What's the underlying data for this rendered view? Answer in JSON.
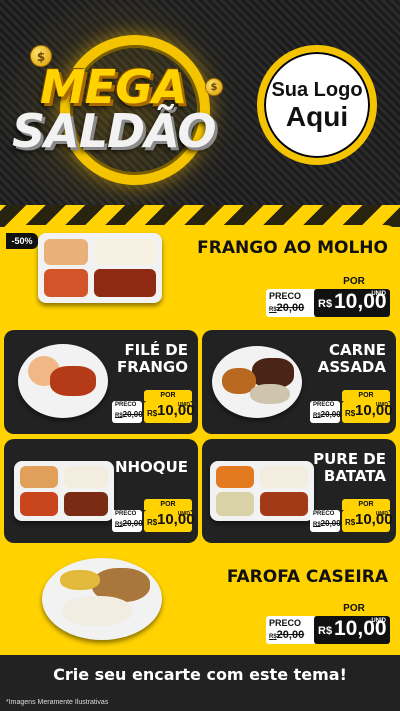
{
  "header": {
    "title_line1": "MEGA",
    "title_line2": "SALDÃO",
    "coin_symbol": "$",
    "logo_line1": "Sua Logo",
    "logo_line2": "Aqui"
  },
  "badge": "-50%",
  "products": [
    {
      "name_lines": [
        "FRANGO AO MOLHO"
      ],
      "price_label": "PRECO",
      "old_price": "20,00",
      "old_prefix": "R$",
      "per_label": "POR",
      "currency": "R$",
      "new_price": "10,00",
      "unit": "UNID"
    },
    {
      "name_lines": [
        "FILÉ DE",
        "FRANGO"
      ],
      "price_label": "PRECO",
      "old_price": "20,00",
      "old_prefix": "R$",
      "per_label": "POR",
      "currency": "R$",
      "new_price": "10,00",
      "unit": "UNID"
    },
    {
      "name_lines": [
        "CARNE",
        "ASSADA"
      ],
      "price_label": "PRECO",
      "old_price": "20,00",
      "old_prefix": "R$",
      "per_label": "POR",
      "currency": "R$",
      "new_price": "10,00",
      "unit": "UNID"
    },
    {
      "name_lines": [
        "NHOQUE"
      ],
      "price_label": "PRECO",
      "old_price": "20,00",
      "old_prefix": "R$",
      "per_label": "POR",
      "currency": "R$",
      "new_price": "10,00",
      "unit": "UNID"
    },
    {
      "name_lines": [
        "PURE DE",
        "BATATA"
      ],
      "price_label": "PRECO",
      "old_price": "20,00",
      "old_prefix": "R$",
      "per_label": "POR",
      "currency": "R$",
      "new_price": "10,00",
      "unit": "UNID"
    },
    {
      "name_lines": [
        "FAROFA CASEIRA"
      ],
      "price_label": "PRECO",
      "old_price": "20,00",
      "old_prefix": "R$",
      "per_label": "POR",
      "currency": "R$",
      "new_price": "10,00",
      "unit": "UNID"
    }
  ],
  "footer": {
    "cta": "Crie seu encarte com este tema!",
    "disclaimer": "*Imagens Meramente Ilustrativas"
  },
  "colors": {
    "brand_yellow": "#ffd200",
    "dark": "#222222",
    "black": "#111111"
  },
  "icons": [
    "coin-icon",
    "food-plate-icon"
  ]
}
